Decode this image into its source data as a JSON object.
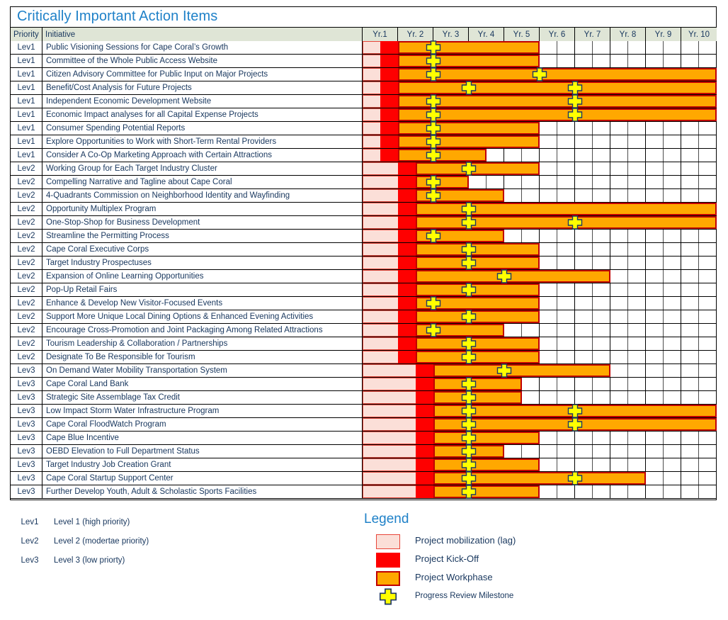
{
  "title": "Critically Important Action Items",
  "columns": {
    "priority_header": "Priority",
    "initiative_header": "Initiative",
    "years": [
      "Yr.1",
      "Yr. 2",
      "Yr. 3",
      "Yr. 4",
      "Yr. 5",
      "Yr. 6",
      "Yr. 7",
      "Yr. 8",
      "Yr. 9",
      "Yr. 10"
    ]
  },
  "priority_legend": [
    {
      "key": "Lev1",
      "description": "Level 1 (high priority)"
    },
    {
      "key": "Lev2",
      "description": "Level 2 (modertae priority)"
    },
    {
      "key": "Lev3",
      "description": "Level 3 (low priorty)"
    }
  ],
  "legend": {
    "title": "Legend",
    "items": [
      {
        "swatch": "lag",
        "label": "Project mobilization (lag)"
      },
      {
        "swatch": "kickoff",
        "label": "Project Kick-Off"
      },
      {
        "swatch": "workphase",
        "label": "Project Workphase"
      },
      {
        "swatch": "milestone",
        "label": "Progress Review Milestone"
      }
    ]
  },
  "colors": {
    "title_blue": "#1f81c8",
    "header_green": "#dfe5d6",
    "text_navy": "#17365d",
    "lag_pink": "#fbdfd8",
    "kickoff_red": "#fe0000",
    "workphase_orange": "#ffa800",
    "workphase_border": "#c00000",
    "milestone_yellow": "#ffff00"
  },
  "chart_data": {
    "type": "gantt",
    "title": "Critically Important Action Items",
    "xlabel": "",
    "ylabel": "",
    "x_axis": {
      "unit": "year",
      "ticks": [
        "Yr.1",
        "Yr. 2",
        "Yr. 3",
        "Yr. 4",
        "Yr. 5",
        "Yr. 6",
        "Yr. 7",
        "Yr. 8",
        "Yr. 9",
        "Yr. 10"
      ],
      "range": [
        1,
        11
      ],
      "minor_gridlines": "half-year"
    },
    "phase_types": [
      "Project mobilization (lag)",
      "Project Kick-Off",
      "Project Workphase",
      "Progress Review Milestone"
    ],
    "tasks": [
      {
        "priority": "Lev1",
        "initiative": "Public Visioning Sessions for Cape Coral’s Growth",
        "lag": [
          1.0,
          1.5
        ],
        "kickoff": [
          1.5,
          2.0
        ],
        "work": [
          2.0,
          6.0
        ],
        "milestones": [
          3.0
        ]
      },
      {
        "priority": "Lev1",
        "initiative": "Committee of the Whole Public Access Website",
        "lag": [
          1.0,
          1.5
        ],
        "kickoff": [
          1.5,
          2.0
        ],
        "work": [
          2.0,
          6.0
        ],
        "milestones": [
          3.0
        ]
      },
      {
        "priority": "Lev1",
        "initiative": "Citizen Advisory Committee for Public Input on Major Projects",
        "lag": [
          1.0,
          1.5
        ],
        "kickoff": [
          1.5,
          2.0
        ],
        "work": [
          2.0,
          11.0
        ],
        "milestones": [
          3.0,
          6.0
        ]
      },
      {
        "priority": "Lev1",
        "initiative": "Benefit/Cost Analysis for Future Projects",
        "lag": [
          1.0,
          1.5
        ],
        "kickoff": [
          1.5,
          2.0
        ],
        "work": [
          2.0,
          11.0
        ],
        "milestones": [
          4.0,
          7.0
        ]
      },
      {
        "priority": "Lev1",
        "initiative": "Independent Economic Development Website",
        "lag": [
          1.0,
          1.5
        ],
        "kickoff": [
          1.5,
          2.0
        ],
        "work": [
          2.0,
          11.0
        ],
        "milestones": [
          3.0,
          7.0
        ]
      },
      {
        "priority": "Lev1",
        "initiative": "Economic Impact analyses for all Capital Expense Projects",
        "lag": [
          1.0,
          1.5
        ],
        "kickoff": [
          1.5,
          2.0
        ],
        "work": [
          2.0,
          11.0
        ],
        "milestones": [
          3.0,
          7.0
        ]
      },
      {
        "priority": "Lev1",
        "initiative": "Consumer Spending Potential Reports",
        "lag": [
          1.0,
          1.5
        ],
        "kickoff": [
          1.5,
          2.0
        ],
        "work": [
          2.0,
          6.0
        ],
        "milestones": [
          3.0
        ]
      },
      {
        "priority": "Lev1",
        "initiative": "Explore Opportunities to Work with Short-Term Rental Providers",
        "lag": [
          1.0,
          1.5
        ],
        "kickoff": [
          1.5,
          2.0
        ],
        "work": [
          2.0,
          6.0
        ],
        "milestones": [
          3.0
        ]
      },
      {
        "priority": "Lev1",
        "initiative": "Consider A Co-Op Marketing Approach with Certain Attractions",
        "lag": [
          1.0,
          1.5
        ],
        "kickoff": [
          1.5,
          2.0
        ],
        "work": [
          2.0,
          4.5
        ],
        "milestones": [
          3.0
        ]
      },
      {
        "priority": "Lev2",
        "initiative": "Working Group for Each Target Industry Cluster",
        "lag": [
          1.0,
          2.0
        ],
        "kickoff": [
          2.0,
          2.5
        ],
        "work": [
          2.5,
          6.0
        ],
        "milestones": [
          4.0
        ]
      },
      {
        "priority": "Lev2",
        "initiative": "Compelling Narrative and Tagline about Cape Coral",
        "lag": [
          1.0,
          2.0
        ],
        "kickoff": [
          2.0,
          2.5
        ],
        "work": [
          2.5,
          4.0
        ],
        "milestones": [
          3.0
        ]
      },
      {
        "priority": "Lev2",
        "initiative": "4-Quadrants Commission on Neighborhood Identity and Wayfinding",
        "lag": [
          1.0,
          2.0
        ],
        "kickoff": [
          2.0,
          2.5
        ],
        "work": [
          2.5,
          5.0
        ],
        "milestones": [
          3.0
        ]
      },
      {
        "priority": "Lev2",
        "initiative": "Opportunity Multiplex Program",
        "lag": [
          1.0,
          2.0
        ],
        "kickoff": [
          2.0,
          2.5
        ],
        "work": [
          2.5,
          11.0
        ],
        "milestones": [
          4.0
        ]
      },
      {
        "priority": "Lev2",
        "initiative": "One-Stop-Shop for Business Development",
        "lag": [
          1.0,
          2.0
        ],
        "kickoff": [
          2.0,
          2.5
        ],
        "work": [
          2.5,
          11.0
        ],
        "milestones": [
          4.0,
          7.0
        ]
      },
      {
        "priority": "Lev2",
        "initiative": "Streamline the Permitting Process",
        "lag": [
          1.0,
          2.0
        ],
        "kickoff": [
          2.0,
          2.5
        ],
        "work": [
          2.5,
          5.0
        ],
        "milestones": [
          3.0
        ]
      },
      {
        "priority": "Lev2",
        "initiative": "Cape Coral Executive Corps",
        "lag": [
          1.0,
          2.0
        ],
        "kickoff": [
          2.0,
          2.5
        ],
        "work": [
          2.5,
          6.0
        ],
        "milestones": [
          4.0
        ]
      },
      {
        "priority": "Lev2",
        "initiative": "Target Industry Prospectuses",
        "lag": [
          1.0,
          2.0
        ],
        "kickoff": [
          2.0,
          2.5
        ],
        "work": [
          2.5,
          6.0
        ],
        "milestones": [
          4.0
        ]
      },
      {
        "priority": "Lev2",
        "initiative": "Expansion of Online Learning Opportunities",
        "lag": [
          1.0,
          2.0
        ],
        "kickoff": [
          2.0,
          2.5
        ],
        "work": [
          2.5,
          8.0
        ],
        "milestones": [
          5.0
        ]
      },
      {
        "priority": "Lev2",
        "initiative": "Pop-Up Retail Fairs",
        "lag": [
          1.0,
          2.0
        ],
        "kickoff": [
          2.0,
          2.5
        ],
        "work": [
          2.5,
          6.0
        ],
        "milestones": [
          4.0
        ]
      },
      {
        "priority": "Lev2",
        "initiative": "Enhance & Develop New Visitor-Focused Events",
        "lag": [
          1.0,
          2.0
        ],
        "kickoff": [
          2.0,
          2.5
        ],
        "work": [
          2.5,
          6.0
        ],
        "milestones": [
          3.0
        ]
      },
      {
        "priority": "Lev2",
        "initiative": "Support More Unique Local Dining Options & Enhanced Evening Activities",
        "lag": [
          1.0,
          2.0
        ],
        "kickoff": [
          2.0,
          2.5
        ],
        "work": [
          2.5,
          6.0
        ],
        "milestones": [
          4.0
        ]
      },
      {
        "priority": "Lev2",
        "initiative": "Encourage Cross-Promotion and Joint Packaging Among Related Attractions",
        "lag": [
          1.0,
          2.0
        ],
        "kickoff": [
          2.0,
          2.5
        ],
        "work": [
          2.5,
          5.0
        ],
        "milestones": [
          3.0
        ]
      },
      {
        "priority": "Lev2",
        "initiative": "Tourism Leadership & Collaboration / Partnerships",
        "lag": [
          1.0,
          2.0
        ],
        "kickoff": [
          2.0,
          2.5
        ],
        "work": [
          2.5,
          6.0
        ],
        "milestones": [
          4.0
        ]
      },
      {
        "priority": "Lev2",
        "initiative": "Designate To Be Responsible for Tourism",
        "lag": [
          1.0,
          2.0
        ],
        "kickoff": [
          2.0,
          2.5
        ],
        "work": [
          2.5,
          6.0
        ],
        "milestones": [
          4.0
        ]
      },
      {
        "priority": "Lev3",
        "initiative": "On Demand Water Mobility Transportation System",
        "lag": [
          1.0,
          2.5
        ],
        "kickoff": [
          2.5,
          3.0
        ],
        "work": [
          3.0,
          8.0
        ],
        "milestones": [
          5.0
        ]
      },
      {
        "priority": "Lev3",
        "initiative": "Cape Coral Land Bank",
        "lag": [
          1.0,
          2.5
        ],
        "kickoff": [
          2.5,
          3.0
        ],
        "work": [
          3.0,
          5.5
        ],
        "milestones": [
          4.0
        ]
      },
      {
        "priority": "Lev3",
        "initiative": "Strategic Site Assemblage Tax Credit",
        "lag": [
          1.0,
          2.5
        ],
        "kickoff": [
          2.5,
          3.0
        ],
        "work": [
          3.0,
          5.5
        ],
        "milestones": [
          4.0
        ]
      },
      {
        "priority": "Lev3",
        "initiative": "Low Impact Storm Water Infrastructure Program",
        "lag": [
          1.0,
          2.5
        ],
        "kickoff": [
          2.5,
          3.0
        ],
        "work": [
          3.0,
          11.0
        ],
        "milestones": [
          4.0,
          7.0
        ]
      },
      {
        "priority": "Lev3",
        "initiative": "Cape Coral FloodWatch Program",
        "lag": [
          1.0,
          2.5
        ],
        "kickoff": [
          2.5,
          3.0
        ],
        "work": [
          3.0,
          11.0
        ],
        "milestones": [
          4.0,
          7.0
        ]
      },
      {
        "priority": "Lev3",
        "initiative": "Cape Blue Incentive",
        "lag": [
          1.0,
          2.5
        ],
        "kickoff": [
          2.5,
          3.0
        ],
        "work": [
          3.0,
          6.0
        ],
        "milestones": [
          4.0
        ]
      },
      {
        "priority": "Lev3",
        "initiative": "OEBD Elevation to Full Department Status",
        "lag": [
          1.0,
          2.5
        ],
        "kickoff": [
          2.5,
          3.0
        ],
        "work": [
          3.0,
          5.0
        ],
        "milestones": [
          4.0
        ]
      },
      {
        "priority": "Lev3",
        "initiative": "Target Industry Job Creation Grant",
        "lag": [
          1.0,
          2.5
        ],
        "kickoff": [
          2.5,
          3.0
        ],
        "work": [
          3.0,
          6.0
        ],
        "milestones": [
          4.0
        ]
      },
      {
        "priority": "Lev3",
        "initiative": "Cape Coral Startup Support Center",
        "lag": [
          1.0,
          2.5
        ],
        "kickoff": [
          2.5,
          3.0
        ],
        "work": [
          3.0,
          9.0
        ],
        "milestones": [
          4.0,
          7.0
        ]
      },
      {
        "priority": "Lev3",
        "initiative": "Further Develop Youth, Adult & Scholastic Sports Facilities",
        "lag": [
          1.0,
          2.5
        ],
        "kickoff": [
          2.5,
          3.0
        ],
        "work": [
          3.0,
          6.0
        ],
        "milestones": [
          4.0
        ]
      }
    ]
  }
}
